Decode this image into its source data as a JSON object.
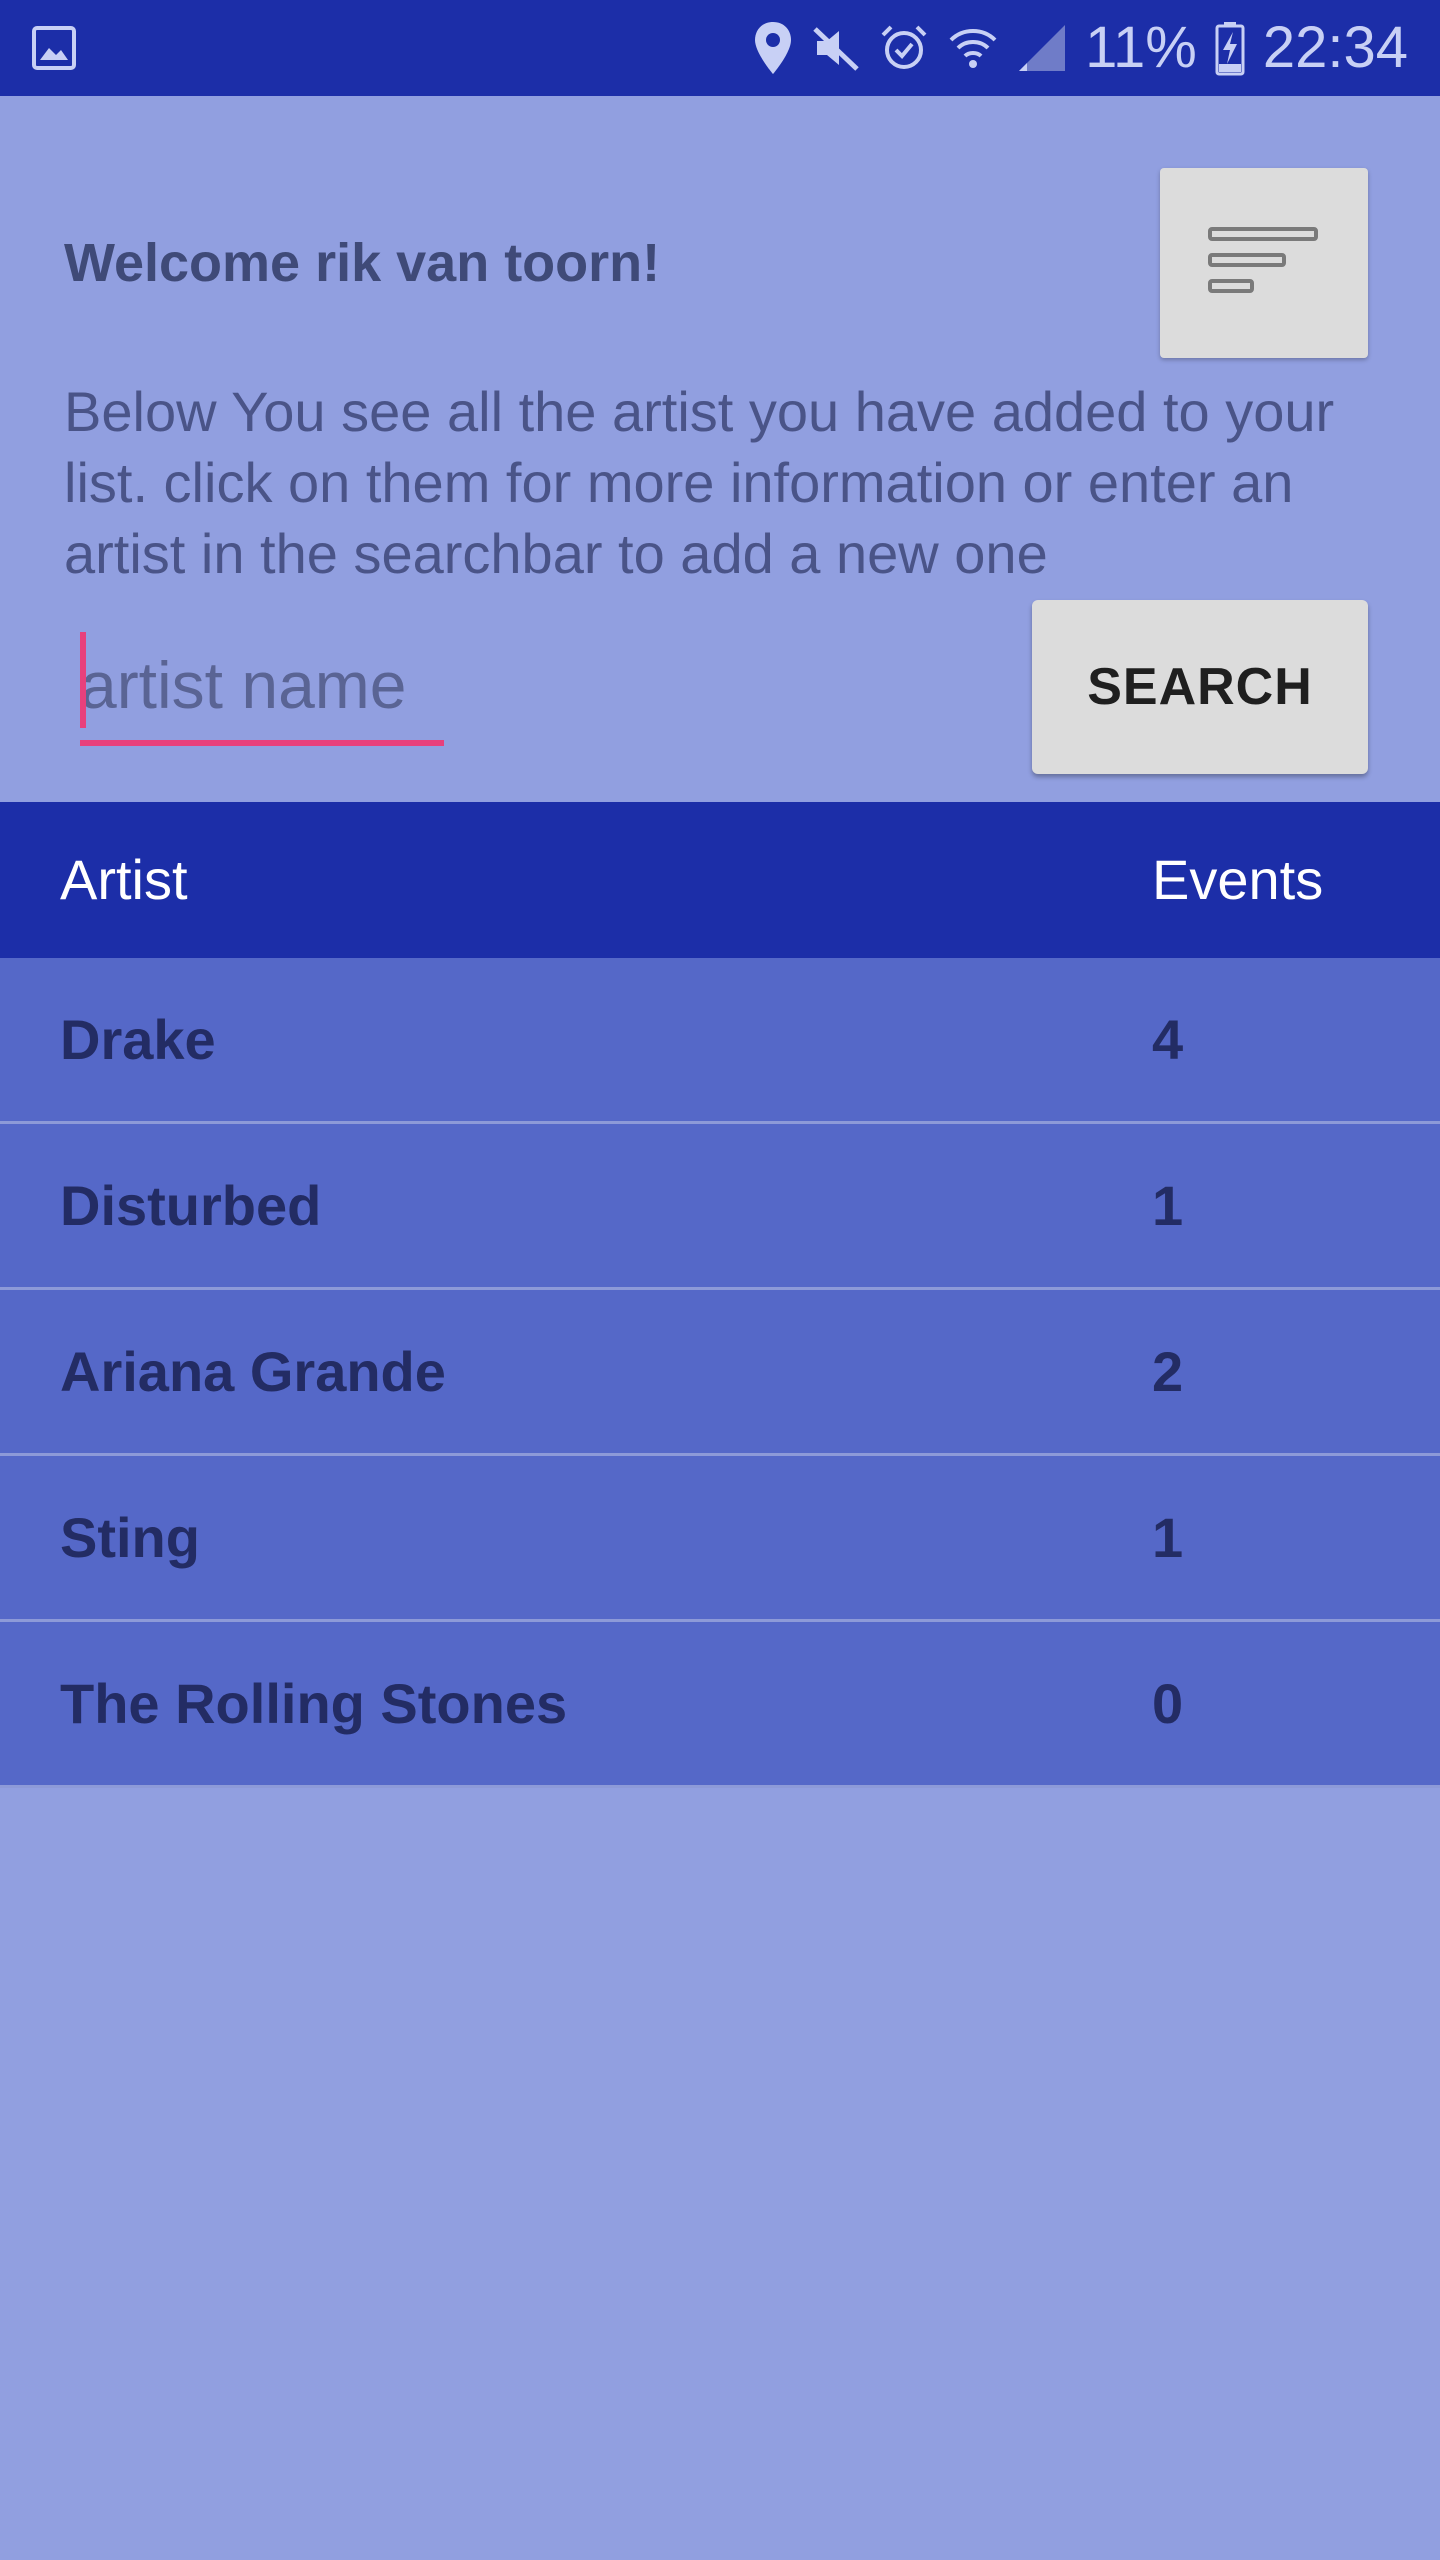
{
  "status_bar": {
    "icons_left": [
      "gallery-icon"
    ],
    "icons_right": [
      "location-icon",
      "mute-icon",
      "alarm-icon",
      "wifi-icon",
      "signal-icon",
      "battery-charging-icon"
    ],
    "battery_percent": "11%",
    "time": "22:34"
  },
  "header": {
    "welcome": "Welcome rik van toorn!",
    "menu_icon": "sort-lines-icon",
    "description": "Below You see all the artist you have added to your list. click on them for more information or enter an artist in the searchbar to add a new one"
  },
  "search": {
    "placeholder": "artist name",
    "value": "",
    "button_label": "SEARCH"
  },
  "table": {
    "headers": {
      "artist": "Artist",
      "events": "Events"
    },
    "rows": [
      {
        "artist": "Drake",
        "events": "4"
      },
      {
        "artist": "Disturbed",
        "events": "1"
      },
      {
        "artist": "Ariana Grande",
        "events": "2"
      },
      {
        "artist": "Sting",
        "events": "1"
      },
      {
        "artist": "The Rolling Stones",
        "events": "0"
      }
    ]
  },
  "colors": {
    "primary": "#1c2ea8",
    "background": "#919fe0",
    "row": "#5568c8",
    "accent": "#e8407c"
  }
}
